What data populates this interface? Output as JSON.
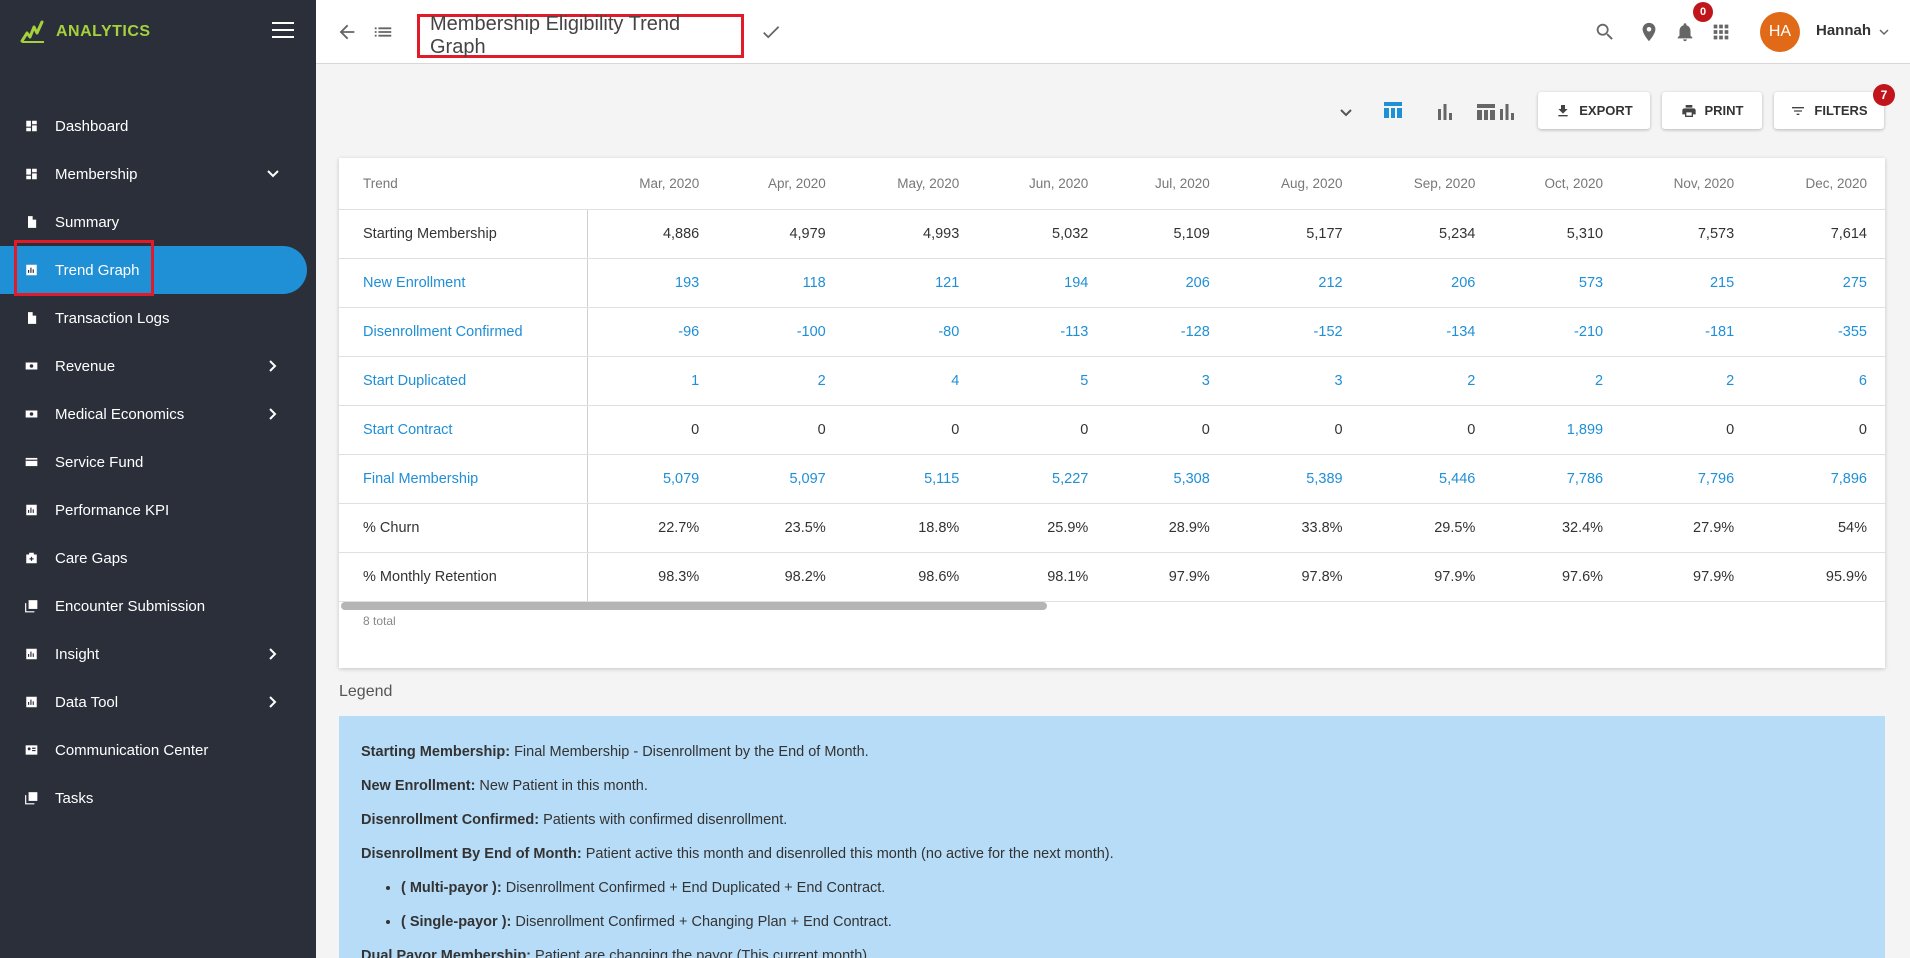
{
  "brand": {
    "name": "ANALYTICS",
    "accent": "#a6d13a"
  },
  "sidebar": {
    "items": [
      {
        "label": "Dashboard",
        "icon": "dashboard-icon"
      },
      {
        "label": "Membership",
        "icon": "dashboard-icon",
        "expanded": true
      },
      {
        "label": "Summary",
        "icon": "document-icon"
      },
      {
        "label": "Trend Graph",
        "icon": "chart-icon",
        "active": true
      },
      {
        "label": "Transaction Logs",
        "icon": "document-icon"
      },
      {
        "label": "Revenue",
        "icon": "money-icon",
        "has_children": true
      },
      {
        "label": "Medical Economics",
        "icon": "money-icon",
        "has_children": true
      },
      {
        "label": "Service Fund",
        "icon": "card-icon"
      },
      {
        "label": "Performance KPI",
        "icon": "chart-icon"
      },
      {
        "label": "Care Gaps",
        "icon": "medkit-icon"
      },
      {
        "label": "Encounter Submission",
        "icon": "library-icon"
      },
      {
        "label": "Insight",
        "icon": "chart-icon",
        "has_children": true
      },
      {
        "label": "Data Tool",
        "icon": "chart-icon",
        "has_children": true
      },
      {
        "label": "Communication Center",
        "icon": "contact-card-icon"
      },
      {
        "label": "Tasks",
        "icon": "library-icon"
      }
    ]
  },
  "header": {
    "title": "Membership Eligibility Trend Graph",
    "notification_count": "0",
    "user": {
      "initials": "HA",
      "name": "Hannah"
    }
  },
  "toolbar": {
    "export_label": "EXPORT",
    "print_label": "PRINT",
    "filters_label": "FILTERS",
    "filters_count": "7"
  },
  "table": {
    "trend_header": "Trend",
    "columns": [
      "Mar, 2020",
      "Apr, 2020",
      "May, 2020",
      "Jun, 2020",
      "Jul, 2020",
      "Aug, 2020",
      "Sep, 2020",
      "Oct, 2020",
      "Nov, 2020",
      "Dec, 2020"
    ],
    "rows": [
      {
        "label": "Starting Membership",
        "link": false,
        "values": [
          "4,886",
          "4,979",
          "4,993",
          "5,032",
          "5,109",
          "5,177",
          "5,234",
          "5,310",
          "7,573",
          "7,614"
        ]
      },
      {
        "label": "New Enrollment",
        "link": true,
        "values": [
          "193",
          "118",
          "121",
          "194",
          "206",
          "212",
          "206",
          "573",
          "215",
          "275"
        ]
      },
      {
        "label": "Disenrollment Confirmed",
        "link": true,
        "values": [
          "-96",
          "-100",
          "-80",
          "-113",
          "-128",
          "-152",
          "-134",
          "-210",
          "-181",
          "-355"
        ]
      },
      {
        "label": "Start Duplicated",
        "link": true,
        "values": [
          "1",
          "2",
          "4",
          "5",
          "3",
          "3",
          "2",
          "2",
          "2",
          "6"
        ]
      },
      {
        "label": "Start Contract",
        "link": true,
        "values": [
          "0",
          "0",
          "0",
          "0",
          "0",
          "0",
          "0",
          "1,899",
          "0",
          "0"
        ],
        "blue_values": [
          7
        ]
      },
      {
        "label": "Final Membership",
        "link": true,
        "values": [
          "5,079",
          "5,097",
          "5,115",
          "5,227",
          "5,308",
          "5,389",
          "5,446",
          "7,786",
          "7,796",
          "7,896"
        ]
      },
      {
        "label": "% Churn",
        "link": false,
        "values": [
          "22.7%",
          "23.5%",
          "18.8%",
          "25.9%",
          "28.9%",
          "33.8%",
          "29.5%",
          "32.4%",
          "27.9%",
          "54%"
        ]
      },
      {
        "label": "% Monthly Retention",
        "link": false,
        "values": [
          "98.3%",
          "98.2%",
          "98.6%",
          "98.1%",
          "97.9%",
          "97.8%",
          "97.9%",
          "97.6%",
          "97.9%",
          "95.9%"
        ]
      }
    ],
    "total_text": "8 total"
  },
  "legend": {
    "title": "Legend",
    "entries": [
      {
        "term": "Starting Membership:",
        "desc": " Final Membership - Disenrollment by the End of Month."
      },
      {
        "term": "New Enrollment:",
        "desc": " New Patient in this month."
      },
      {
        "term": "Disenrollment Confirmed:",
        "desc": " Patients with confirmed disenrollment."
      },
      {
        "term": "Disenrollment By End of Month:",
        "desc": " Patient active this month and disenrolled this month (no active for the next month)."
      }
    ],
    "sub_entries": [
      {
        "term": "( Multi-payor ):",
        "desc": " Disenrollment Confirmed + End Duplicated + End Contract."
      },
      {
        "term": "( Single-payor ):",
        "desc": " Disenrollment Confirmed + Changing Plan + End Contract."
      }
    ],
    "last_entry": {
      "term": "Dual Payor Membership:",
      "desc": " Patient are changing the payor (This current month)."
    }
  },
  "colors": {
    "sidebar_bg": "#2b2f3a",
    "active_blue": "#1f8fd6",
    "badge_red": "#c0161b",
    "legend_bg": "#b7dcf7",
    "avatar": "#e06a17"
  }
}
